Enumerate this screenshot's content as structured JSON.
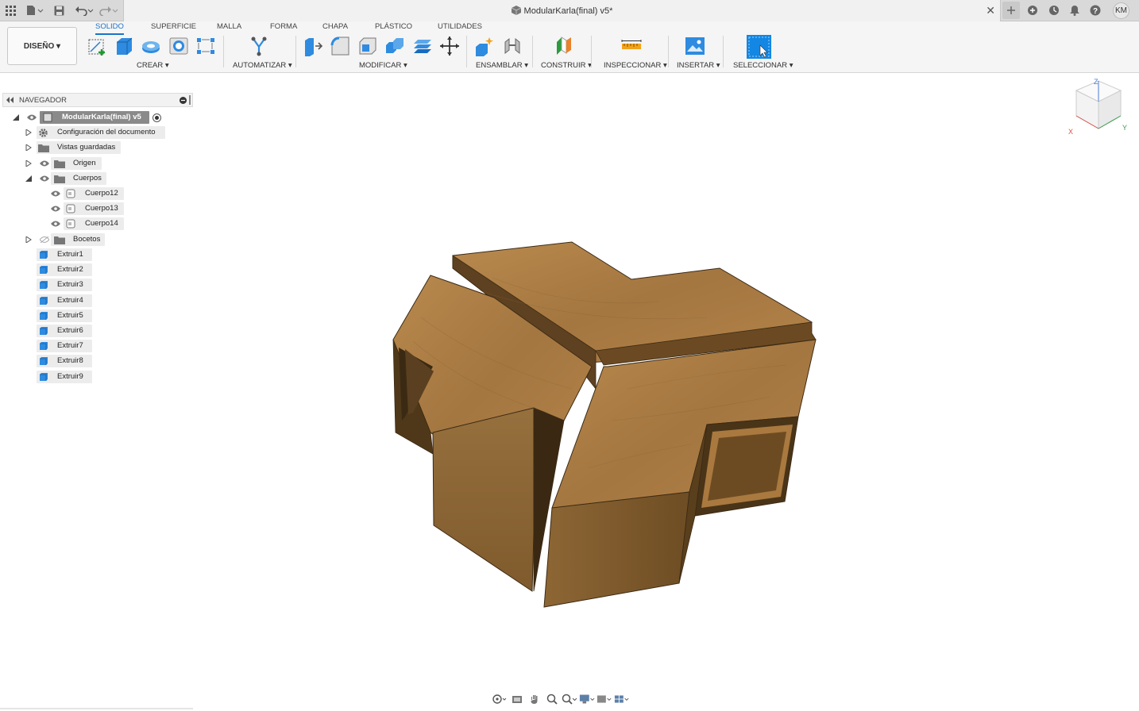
{
  "window": {
    "title": "ModularKarla(final) v5*",
    "user_initials": "KM"
  },
  "ribbon": {
    "workspace": "DISEÑO ▾",
    "tabs": [
      {
        "label": "SOLIDO",
        "active": true
      },
      {
        "label": "SUPERFICIE",
        "active": false
      },
      {
        "label": "MALLA",
        "active": false
      },
      {
        "label": "FORMA",
        "active": false
      },
      {
        "label": "CHAPA",
        "active": false
      },
      {
        "label": "PLÁSTICO",
        "active": false
      },
      {
        "label": "UTILIDADES",
        "active": false
      }
    ],
    "groups": {
      "crear": "CREAR ▾",
      "automatizar": "AUTOMATIZAR ▾",
      "modificar": "MODIFICAR ▾",
      "ensamblar": "ENSAMBLAR ▾",
      "construir": "CONSTRUIR ▾",
      "inspeccionar": "INSPECCIONAR ▾",
      "insertar": "INSERTAR ▾",
      "seleccionar": "SELECCIONAR ▾"
    }
  },
  "navigator": {
    "title": "NAVEGADOR",
    "root": "ModularKarla(final) v5",
    "items": {
      "config": "Configuración del documento",
      "views": "Vistas guardadas",
      "origin": "Origen",
      "bodies": "Cuerpos",
      "body12": "Cuerpo12",
      "body13": "Cuerpo13",
      "body14": "Cuerpo14",
      "sketches": "Bocetos"
    },
    "features": [
      "Extruir1",
      "Extruir2",
      "Extruir3",
      "Extruir4",
      "Extruir5",
      "Extruir6",
      "Extruir7",
      "Extruir8",
      "Extruir9"
    ]
  },
  "viewcube": {
    "axis_z": "Z",
    "axis_x": "X",
    "axis_y": "Y"
  },
  "colors": {
    "accent": "#1a73c8",
    "wood": "#a6783f",
    "wood_dark": "#6e4a22"
  }
}
